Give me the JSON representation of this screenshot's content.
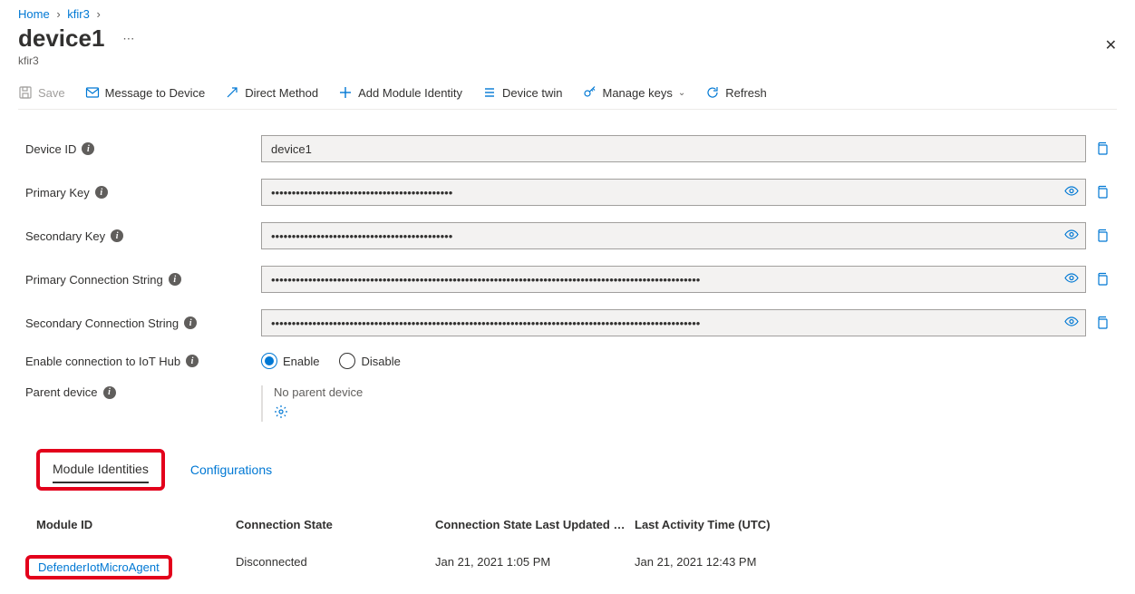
{
  "breadcrumb": {
    "home": "Home",
    "hub": "kfir3"
  },
  "header": {
    "title": "device1",
    "subtitle": "kfir3"
  },
  "toolbar": {
    "save": "Save",
    "message": "Message to Device",
    "direct": "Direct Method",
    "addmodule": "Add Module Identity",
    "twin": "Device twin",
    "keys": "Manage keys",
    "refresh": "Refresh"
  },
  "labels": {
    "deviceId": "Device ID",
    "primaryKey": "Primary Key",
    "secondaryKey": "Secondary Key",
    "primaryConn": "Primary Connection String",
    "secondaryConn": "Secondary Connection String",
    "enableConn": "Enable connection to IoT Hub",
    "parent": "Parent device"
  },
  "values": {
    "deviceId": "device1",
    "primaryKey": "••••••••••••••••••••••••••••••••••••••••••••",
    "secondaryKey": "••••••••••••••••••••••••••••••••••••••••••••",
    "primaryConn": "••••••••••••••••••••••••••••••••••••••••••••••••••••••••••••••••••••••••••••••••••••••••••••••••••••••••",
    "secondaryConn": "••••••••••••••••••••••••••••••••••••••••••••••••••••••••••••••••••••••••••••••••••••••••••••••••••••••••"
  },
  "radio": {
    "enable": "Enable",
    "disable": "Disable"
  },
  "parent": {
    "none": "No parent device"
  },
  "tabs": {
    "modules": "Module Identities",
    "configs": "Configurations"
  },
  "table": {
    "headers": {
      "id": "Module ID",
      "cs": "Connection State",
      "lu": "Connection State Last Updated …",
      "la": "Last Activity Time (UTC)"
    },
    "row": {
      "id": "DefenderIotMicroAgent",
      "cs": "Disconnected",
      "lu": "Jan 21, 2021 1:05 PM",
      "la": "Jan 21, 2021 12:43 PM"
    }
  }
}
